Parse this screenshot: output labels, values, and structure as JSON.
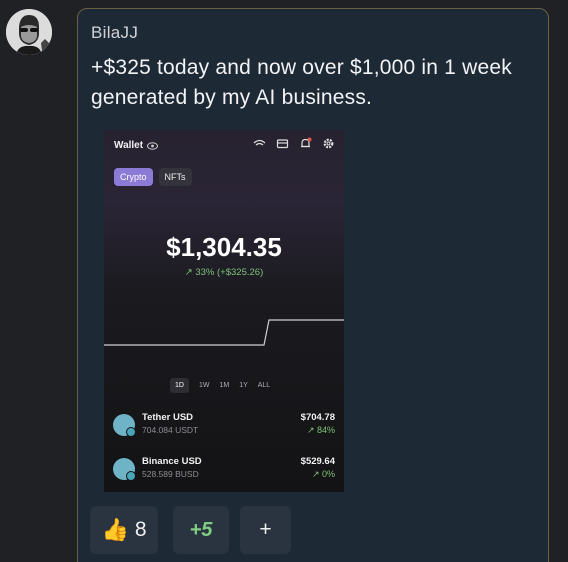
{
  "post": {
    "author": "BilaJJ",
    "message": "+$325 today and now over $1,000 in 1 week generated by my AI business."
  },
  "wallet": {
    "title": "Wallet",
    "tabs": [
      "Crypto",
      "NFTs"
    ],
    "balance": "$1,304.35",
    "change": "↗ 33% (+$325.26)",
    "periods": [
      "1D",
      "1W",
      "1M",
      "1Y",
      "ALL"
    ],
    "assets": [
      {
        "name": "Tether USD",
        "amount": "704.084 USDT",
        "value": "$704.78",
        "pct": "↗ 84%"
      },
      {
        "name": "Binance USD",
        "amount": "528.589 BUSD",
        "value": "$529.64",
        "pct": "↗ 0%"
      }
    ]
  },
  "reactions": {
    "thumbs_count": "8",
    "plus_five": "+5",
    "add": "+"
  },
  "colors": {
    "background": "#1f2125",
    "bubble": "#1e2936",
    "bubble_border": "#6b6243",
    "accent_purple": "#8b7bd6",
    "positive_green": "#7fc47a"
  },
  "icons": {
    "avatar": "avatar",
    "eye": "eye-icon",
    "signal": "signal-icon",
    "card": "card-icon",
    "bell": "bell-icon",
    "settings": "gear-icon",
    "thumbs_up": "thumbs-up-icon",
    "add_reaction": "plus-icon"
  }
}
